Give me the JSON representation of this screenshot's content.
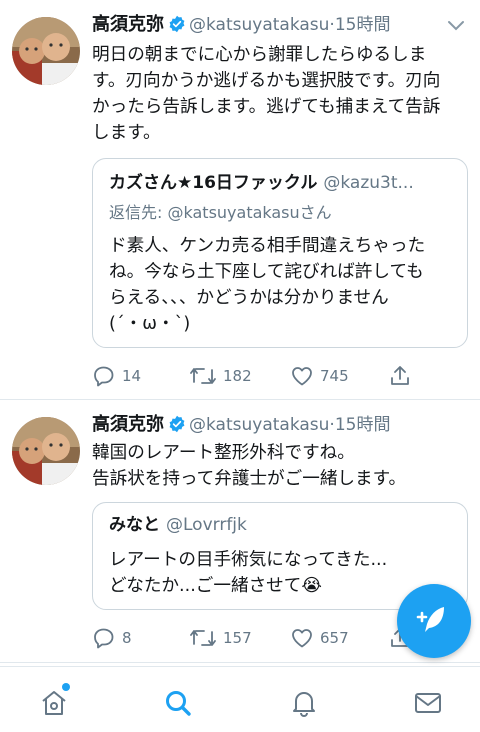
{
  "tweets": [
    {
      "author": "高須克弥",
      "handle": "@katsuyatakasu",
      "time": "15時間",
      "text_lines": [
        "明日の朝までに心から謝罪したらゆるしま",
        "す。刃向かうか逃げるかも選択肢です。刃向",
        "かったら告訴します。逃げても捕まえて告訴",
        "します。"
      ],
      "quote": {
        "name": "カズさん★16日ファックル",
        "handle": "@kazu3t...",
        "reply_prefix": "返信先:",
        "reply_user": "@katsuyatakasu",
        "reply_suffix": "さん",
        "text_lines": [
          "ド素人、ケンカ売る相手間違えちゃった",
          "ね。今なら土下座して詫びれば許しても",
          "らえる、、、かどうかは分かりません",
          "(´・ω・`)"
        ]
      },
      "replies": "14",
      "retweets": "182",
      "likes": "745"
    },
    {
      "author": "高須克弥",
      "handle": "@katsuyatakasu",
      "time": "15時間",
      "text_lines": [
        "韓国のレアート整形外科ですね。",
        "告訴状を持って弁護士がご一緒します。"
      ],
      "quote": {
        "name": "みなと",
        "handle": "@Lovrrfjk",
        "text_lines": [
          "レアートの目手術気になってきた...",
          "どなたか...ご一緒させて😭"
        ]
      },
      "replies": "8",
      "retweets": "157",
      "likes": "657"
    }
  ],
  "colors": {
    "accent": "#1da1f2",
    "secondary_text": "#657786",
    "border": "#ccd6dd"
  },
  "icons": [
    "verified-icon",
    "caret-down-icon",
    "reply-icon",
    "retweet-icon",
    "like-icon",
    "share-icon",
    "compose-icon",
    "home-icon",
    "search-icon",
    "notifications-icon",
    "messages-icon"
  ]
}
